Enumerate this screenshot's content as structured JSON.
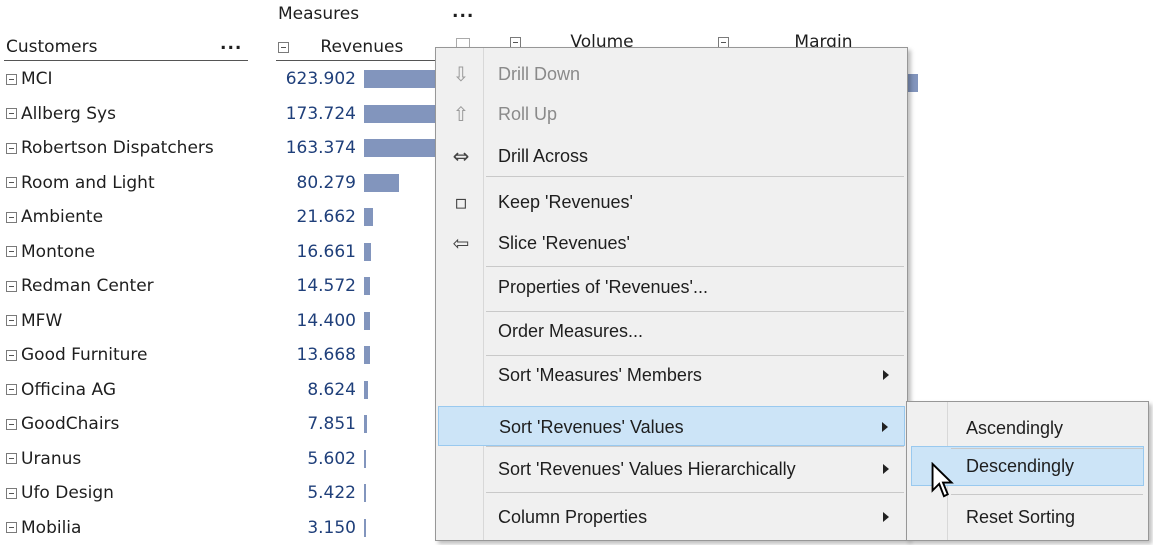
{
  "header": {
    "measures_label": "Measures",
    "measures_more": "...",
    "customers_label": "Customers",
    "customers_more": "...",
    "col_revenues": "Revenues",
    "col_volume": "Volume",
    "col_margin": "Margin"
  },
  "rows": [
    {
      "customer": "MCI",
      "revenue": "623.902",
      "revenue_value": 623.902
    },
    {
      "customer": "Allberg Sys",
      "revenue": "173.724",
      "revenue_value": 173.724
    },
    {
      "customer": "Robertson Dispatchers",
      "revenue": "163.374",
      "revenue_value": 163.374
    },
    {
      "customer": "Room and Light",
      "revenue": "80.279",
      "revenue_value": 80.279
    },
    {
      "customer": "Ambiente",
      "revenue": "21.662",
      "revenue_value": 21.662
    },
    {
      "customer": "Montone",
      "revenue": "16.661",
      "revenue_value": 16.661
    },
    {
      "customer": "Redman Center",
      "revenue": "14.572",
      "revenue_value": 14.572
    },
    {
      "customer": "MFW",
      "revenue": "14.400",
      "revenue_value": 14.4
    },
    {
      "customer": "Good Furniture",
      "revenue": "13.668",
      "revenue_value": 13.668
    },
    {
      "customer": "Officina AG",
      "revenue": "8.624",
      "revenue_value": 8.624
    },
    {
      "customer": "GoodChairs",
      "revenue": "7.851",
      "revenue_value": 7.851
    },
    {
      "customer": "Uranus",
      "revenue": "5.602",
      "revenue_value": 5.602
    },
    {
      "customer": "Ufo Design",
      "revenue": "5.422",
      "revenue_value": 5.422
    },
    {
      "customer": "Mobilia",
      "revenue": "3.150",
      "revenue_value": 3.15
    }
  ],
  "bar_color": "#8295bd",
  "value_color": "#1f3f7a",
  "highlight_color": "#cce4f7",
  "context_menu": {
    "items": [
      {
        "label": "Drill Down",
        "icon": "arrow-down-icon",
        "glyph": "⇩",
        "disabled": true
      },
      {
        "label": "Roll Up",
        "icon": "arrow-up-icon",
        "glyph": "⇧",
        "disabled": true
      },
      {
        "label": "Drill Across",
        "icon": "arrow-left-right-icon",
        "glyph": "⇔",
        "disabled": false
      },
      {
        "label": "Keep 'Revenues'",
        "icon": "square-icon",
        "glyph": "▫",
        "disabled": false
      },
      {
        "label": "Slice 'Revenues'",
        "icon": "arrow-left-icon",
        "glyph": "⇦",
        "disabled": false
      },
      {
        "label": "Properties of 'Revenues'...",
        "disabled": false
      },
      {
        "label": "Order Measures...",
        "disabled": false
      },
      {
        "label": "Sort 'Measures' Members",
        "submenu": true
      },
      {
        "label": "Sort 'Revenues' Values",
        "submenu": true,
        "highlighted": true
      },
      {
        "label": "Sort 'Revenues' Values Hierarchically",
        "submenu": true
      },
      {
        "label": "Column Properties",
        "submenu": true
      }
    ]
  },
  "sort_submenu": {
    "items": [
      {
        "label": "Ascendingly"
      },
      {
        "label": "Descendingly",
        "highlighted": true
      },
      {
        "label": "Reset Sorting"
      }
    ]
  }
}
